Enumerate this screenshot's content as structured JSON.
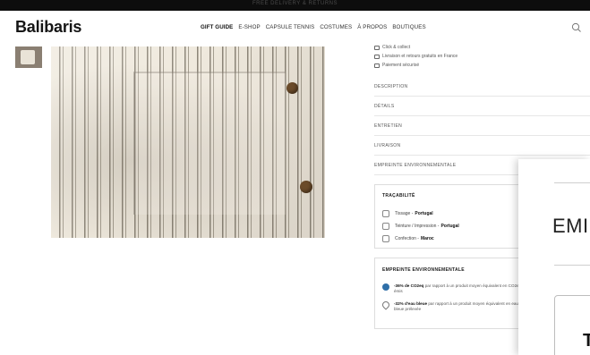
{
  "top_banner": {
    "text": "FREE DELIVERY & RETURNS"
  },
  "header": {
    "logo": "Balibaris",
    "nav": [
      "GIFT GUIDE",
      "E-SHOP",
      "CAPSULE TENNIS",
      "COSTUMES",
      "À PROPOS",
      "BOUTIQUES"
    ],
    "active_nav_index": 0
  },
  "product_info": {
    "lines": [
      {
        "icon": "store-icon",
        "text": "Click & collect"
      },
      {
        "icon": "truck-icon",
        "text": "Livraison et retours gratuits en France"
      },
      {
        "icon": "card-icon",
        "text": "Paiement sécurisé"
      }
    ],
    "accordions": [
      "DESCRIPTION",
      "DÉTAILS",
      "ENTRETIEN",
      "LIVRAISON",
      "EMPREINTE ENVIRONNEMENTALE"
    ]
  },
  "traceability": {
    "title": "TRAÇABILITÉ",
    "rows": [
      {
        "icon": "yarn-icon",
        "label": "Tissage -",
        "value": "Portugal"
      },
      {
        "icon": "dye-icon",
        "label": "Teinture / Impression -",
        "value": "Portugal"
      },
      {
        "icon": "shirt-icon",
        "label": "Confection -",
        "value": "Maroc"
      }
    ]
  },
  "environment": {
    "title": "EMPREINTE ENVIRONNEMENTALE",
    "rows": [
      {
        "icon": "globe-icon",
        "bold": "-36% de CO2eq",
        "text": " par rapport à un produit moyen équivalent en CO2eq émis"
      },
      {
        "icon": "water-drop-icon",
        "bold": "-32% d'eau bleue",
        "text": " par rapport à un produit moyen équivalent en eau bleue prélevée"
      }
    ]
  },
  "modal": {
    "heading": "EMI",
    "card_letter": "T"
  },
  "colors": {
    "accent": "#151515",
    "border": "#dddddd",
    "button_brown": "#6b4b2a",
    "globe": "#2f6fa8"
  }
}
